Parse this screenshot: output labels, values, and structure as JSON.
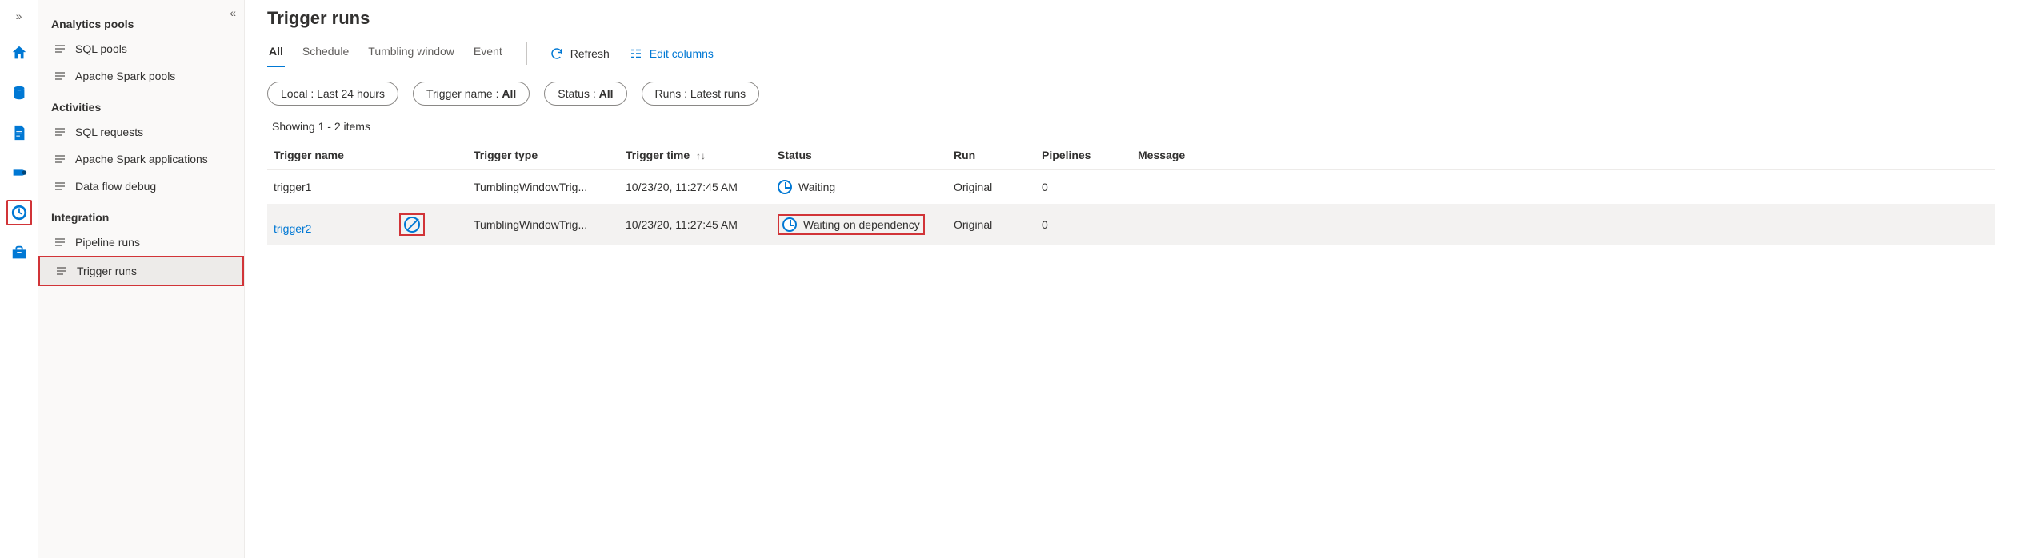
{
  "rail": {
    "icons": [
      "home",
      "database",
      "document",
      "pipeline",
      "monitor",
      "toolbox"
    ],
    "selected": "monitor"
  },
  "side": {
    "groups": [
      {
        "title": "Analytics pools",
        "items": [
          {
            "label": "SQL pools"
          },
          {
            "label": "Apache Spark pools"
          }
        ]
      },
      {
        "title": "Activities",
        "items": [
          {
            "label": "SQL requests"
          },
          {
            "label": "Apache Spark applications"
          },
          {
            "label": "Data flow debug"
          }
        ]
      },
      {
        "title": "Integration",
        "items": [
          {
            "label": "Pipeline runs"
          },
          {
            "label": "Trigger runs",
            "active": true
          }
        ]
      }
    ]
  },
  "header": {
    "title": "Trigger runs"
  },
  "tabs": [
    "All",
    "Schedule",
    "Tumbling window",
    "Event"
  ],
  "active_tab": "All",
  "toolbar": {
    "refresh": "Refresh",
    "edit_columns": "Edit columns"
  },
  "filters": [
    {
      "prefix": "Local : ",
      "value": "Last 24 hours"
    },
    {
      "prefix": "Trigger name : ",
      "value": "All",
      "bold": true
    },
    {
      "prefix": "Status : ",
      "value": "All",
      "bold": true
    },
    {
      "prefix": "Runs : ",
      "value": "Latest runs"
    }
  ],
  "showing": "Showing 1 - 2 items",
  "columns": {
    "trigger_name": "Trigger name",
    "trigger_type": "Trigger type",
    "trigger_time": "Trigger time",
    "status": "Status",
    "run": "Run",
    "pipelines": "Pipelines",
    "message": "Message"
  },
  "rows": [
    {
      "name": "trigger1",
      "type": "TumblingWindowTrig...",
      "time": "10/23/20, 11:27:45 AM",
      "status": "Waiting",
      "run": "Original",
      "pipelines": "0",
      "message": "",
      "link": false,
      "hover": false,
      "highlight_status": false,
      "show_cancel": false
    },
    {
      "name": "trigger2",
      "type": "TumblingWindowTrig...",
      "time": "10/23/20, 11:27:45 AM",
      "status": "Waiting on dependency",
      "run": "Original",
      "pipelines": "0",
      "message": "",
      "link": true,
      "hover": true,
      "highlight_status": true,
      "show_cancel": true
    }
  ]
}
